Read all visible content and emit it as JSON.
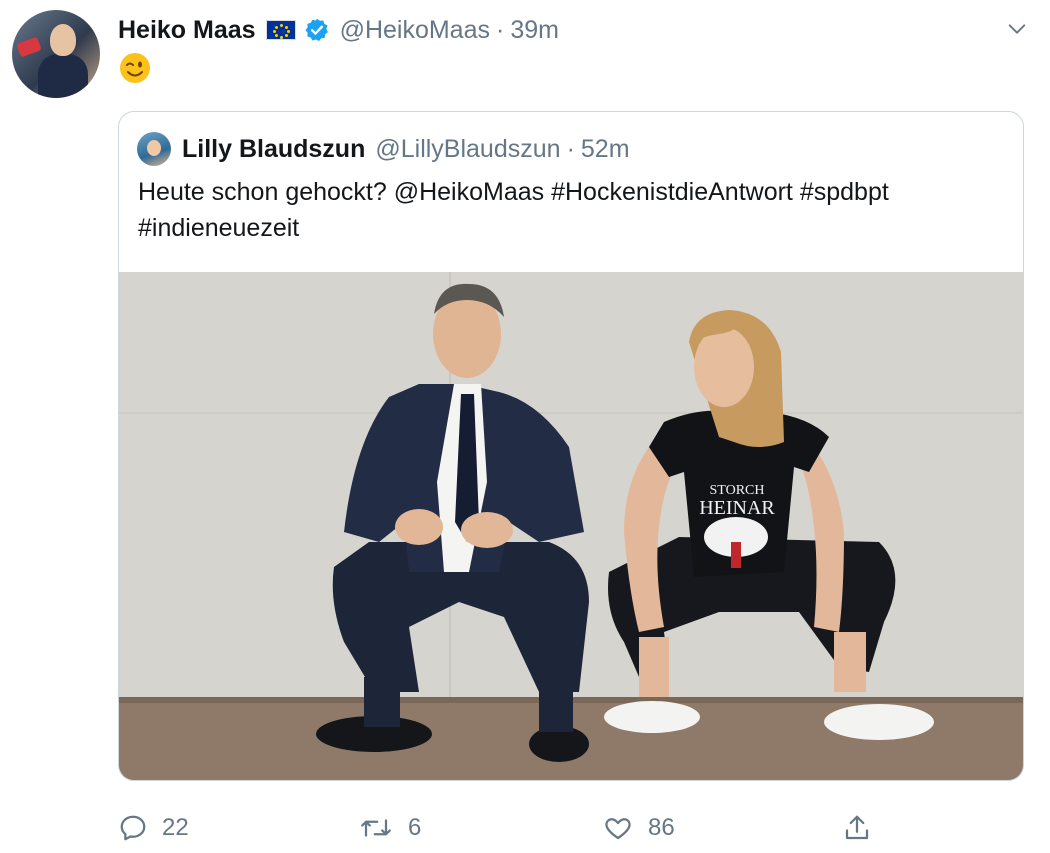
{
  "tweet": {
    "author_name": "Heiko Maas",
    "author_handle": "@HeikoMaas",
    "separator": "·",
    "time": "39m",
    "emoji": "😉",
    "flag_icon": "eu-flag-icon",
    "verified_icon": "verified-badge-icon",
    "menu_icon": "chevron-down-icon"
  },
  "quoted": {
    "author_name": "Lilly Blaudszun",
    "author_handle": "@LillyBlaudszun",
    "separator": "·",
    "time": "52m",
    "text": "Heute schon gehockt? @HeikoMaas #HockenistdieAntwort #spdbpt #indieneuezeit",
    "shirt_text_top": "STORCH",
    "shirt_text_bottom": "HEINAR"
  },
  "actions": {
    "reply_count": "22",
    "retweet_count": "6",
    "like_count": "86",
    "reply_icon": "reply-icon",
    "retweet_icon": "retweet-icon",
    "like_icon": "heart-icon",
    "share_icon": "share-icon"
  },
  "colors": {
    "text": "#14171a",
    "muted": "#657786",
    "verified": "#1da1f2",
    "border": "#ccd6dd"
  }
}
